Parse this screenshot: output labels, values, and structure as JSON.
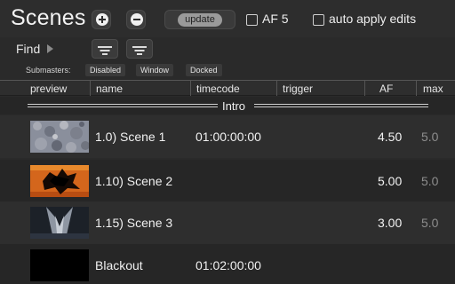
{
  "header": {
    "title": "Scenes",
    "update_label": "update",
    "af_checkbox_label": "AF 5",
    "auto_apply_label": "auto apply edits"
  },
  "find": {
    "label": "Find"
  },
  "submasters": {
    "label": "Submasters:",
    "options": [
      "Disabled",
      "Window",
      "Docked"
    ]
  },
  "columns": {
    "preview": "preview",
    "name": "name",
    "timecode": "timecode",
    "trigger": "trigger",
    "af": "AF",
    "max": "max"
  },
  "group": {
    "title": "Intro"
  },
  "scenes": [
    {
      "name": "1.0) Scene 1",
      "timecode": "01:00:00:00",
      "af": "4.50",
      "max": "5.0",
      "thumb": "rocky-texture"
    },
    {
      "name": "1.10) Scene 2",
      "timecode": "",
      "af": "5.00",
      "max": "5.0",
      "thumb": "fire-burst"
    },
    {
      "name": "1.15) Scene 3",
      "timecode": "",
      "af": "3.00",
      "max": "5.0",
      "thumb": "water-splash"
    },
    {
      "name": "Blackout",
      "timecode": "01:02:00:00",
      "af": "",
      "max": "",
      "thumb": "black"
    }
  ],
  "colors": {
    "background": "#2a2a2a",
    "text": "#f0f0f0",
    "max_text": "#8d8d8d"
  }
}
